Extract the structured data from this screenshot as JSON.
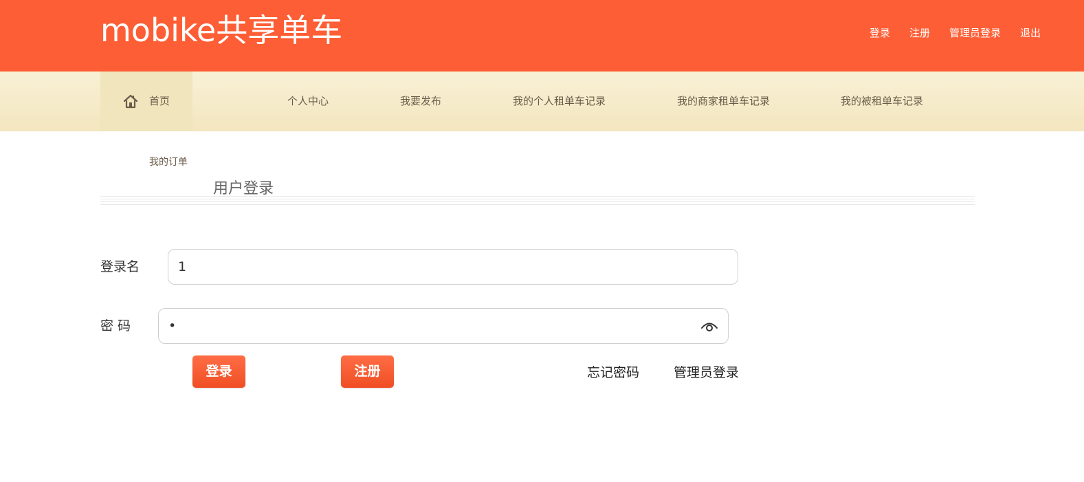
{
  "brand": {
    "title": "mobike共享单车",
    "accent_color": "#fe5e35"
  },
  "top_links": [
    {
      "label": "登录"
    },
    {
      "label": "注册"
    },
    {
      "label": "管理员登录"
    },
    {
      "label": "退出"
    }
  ],
  "nav": {
    "home": {
      "label": "首页",
      "icon": "home-icon"
    },
    "items": [
      {
        "label": "个人中心"
      },
      {
        "label": "我要发布"
      },
      {
        "label": "我的个人租单车记录"
      },
      {
        "label": "我的商家租单车记录"
      },
      {
        "label": "我的被租单车记录"
      }
    ],
    "orders": {
      "label": "我的订单"
    }
  },
  "section": {
    "title": "用户登录"
  },
  "form": {
    "username": {
      "label": "登录名",
      "value": "1"
    },
    "password": {
      "label": "密 码",
      "value": "•",
      "toggle_icon": "eye-icon"
    },
    "login_button": "登录",
    "register_button": "注册",
    "forgot_link": "忘记密码",
    "admin_link": "管理员登录"
  }
}
